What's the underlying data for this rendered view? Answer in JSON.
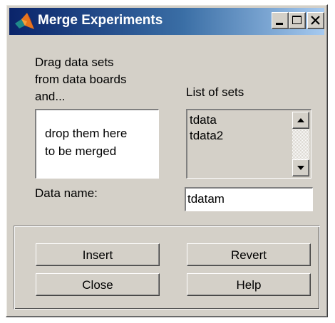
{
  "window": {
    "title": "Merge Experiments",
    "icon": "matlab-logo-icon",
    "controls": [
      "minimize-icon",
      "maximize-icon",
      "close-icon"
    ]
  },
  "instructions": {
    "line1": "Drag data sets",
    "line2": "from data boards",
    "line3": "and...",
    "drop_line1": "drop them here",
    "drop_line2": "to be merged"
  },
  "list": {
    "label": "List of sets",
    "items": [
      "tdata",
      "tdata2"
    ]
  },
  "data_name": {
    "label": "Data name:",
    "value": "tdatam"
  },
  "buttons": {
    "insert": "Insert",
    "revert": "Revert",
    "close": "Close",
    "help": "Help"
  },
  "colors": {
    "face": "#d4d0c8",
    "title_start": "#0a246a",
    "title_end": "#a6caf0"
  }
}
